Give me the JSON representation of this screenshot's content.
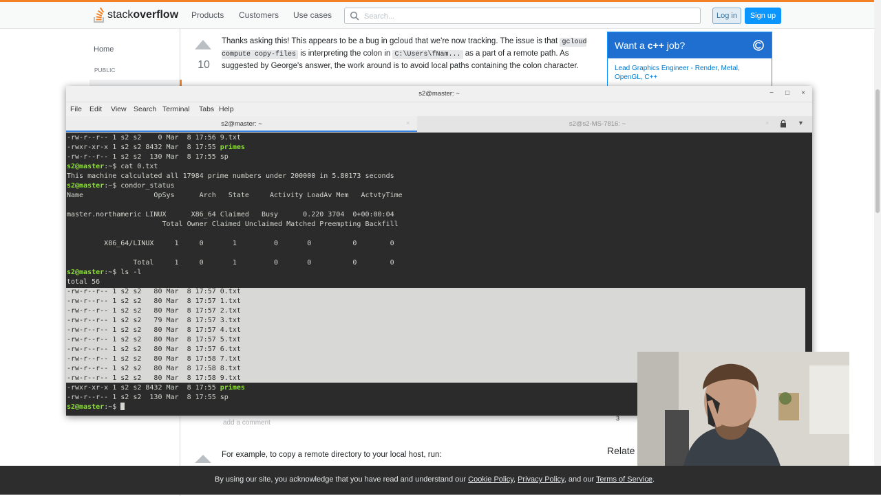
{
  "so": {
    "logo_prefix": "stack",
    "logo_bold": "overflow",
    "nav": [
      "Products",
      "Customers",
      "Use cases"
    ],
    "search_placeholder": "Search...",
    "login": "Log in",
    "signup": "Sign up",
    "home": "Home",
    "public": "PUBLIC",
    "vote_count": "10",
    "answer": {
      "t1": "Thanks asking this! This appears to be a bug in gcloud that we're now tracking. The issue is that ",
      "c1": "gcloud compute copy-files",
      "t2": " is interpreting the colon in ",
      "c2": "C:\\Users\\fNam...",
      "t3": " as a part of a remote path. As suggested by George's answer, the work around is to avoid local paths containing the colon character."
    },
    "job": {
      "title_a": "Want a ",
      "title_b": "c++",
      "title_c": " job?",
      "link": "Lead Graphics Engineer - Render, Metal, OpenGL, C++"
    },
    "add_comment": "add a comment",
    "example": "For example, to copy a remote directory to your local host, run:",
    "related": "Relate",
    "related_num": "3",
    "cookie": {
      "t1": "By using our site, you acknowledge that you have read and understand our ",
      "l1": "Cookie Policy",
      "t2": ", ",
      "l2": "Privacy Policy",
      "t3": ", and our ",
      "l3": "Terms of Service",
      "t4": "."
    }
  },
  "terminal": {
    "title": "s2@master: ~",
    "menu": [
      "File",
      "Edit",
      "View",
      "Search",
      "Terminal",
      "Tabs",
      "Help"
    ],
    "tab1": "s2@master: ~",
    "tab2": "s2@s2-MS-7816: ~",
    "lines": [
      "-rw-r--r-- 1 s2 s2    0 Mar  8 17:56 9.txt",
      "-rwxr-xr-x 1 s2 s2 8432 Mar  8 17:55 ",
      "-rw-r--r-- 1 s2 s2  130 Mar  8 17:55 sp",
      "s2@master:~$ cat 0.txt",
      "This machine calculated all 17984 prime numbers under 200000 in 5.80173 seconds",
      "s2@master:~$ condor_status",
      "Name                 OpSys      Arch   State     Activity LoadAv Mem   ActvtyTime",
      "",
      "master.northameric LINUX      X86_64 Claimed   Busy      0.220 3704  0+00:00:04",
      "                       Total Owner Claimed Unclaimed Matched Preempting Backfill",
      "",
      "         X86_64/LINUX     1     0       1         0       0          0        0",
      "",
      "                Total     1     0       1         0       0          0        0",
      "s2@master:~$ ls -l",
      "total 56",
      "-rw-r--r-- 1 s2 s2   80 Mar  8 17:57 0.txt",
      "-rw-r--r-- 1 s2 s2   80 Mar  8 17:57 1.txt",
      "-rw-r--r-- 1 s2 s2   80 Mar  8 17:57 2.txt",
      "-rw-r--r-- 1 s2 s2   79 Mar  8 17:57 3.txt",
      "-rw-r--r-- 1 s2 s2   80 Mar  8 17:57 4.txt",
      "-rw-r--r-- 1 s2 s2   80 Mar  8 17:57 5.txt",
      "-rw-r--r-- 1 s2 s2   80 Mar  8 17:57 6.txt",
      "-rw-r--r-- 1 s2 s2   80 Mar  8 17:58 7.txt",
      "-rw-r--r-- 1 s2 s2   80 Mar  8 17:58 8.txt",
      "-rw-r--r-- 1 s2 s2   80 Mar  8 17:58 9.txt",
      "-rwxr-xr-x 1 s2 s2 8432 Mar  8 17:55 ",
      "-rw-r--r-- 1 s2 s2  130 Mar  8 17:55 sp",
      "s2@master:~$ "
    ],
    "primes_label": "primes",
    "prompt_user": "s2@master",
    "colors": {
      "bg": "#2b2b2b",
      "fg": "#d3d7cf",
      "green": "#8ae234",
      "selection": "#d8d8d6"
    }
  },
  "colors": {
    "so_orange": "#f48024",
    "so_blue": "#0a95ff",
    "job_blue": "#1e6fcf",
    "cookie_bg": "#2d2d2d"
  }
}
